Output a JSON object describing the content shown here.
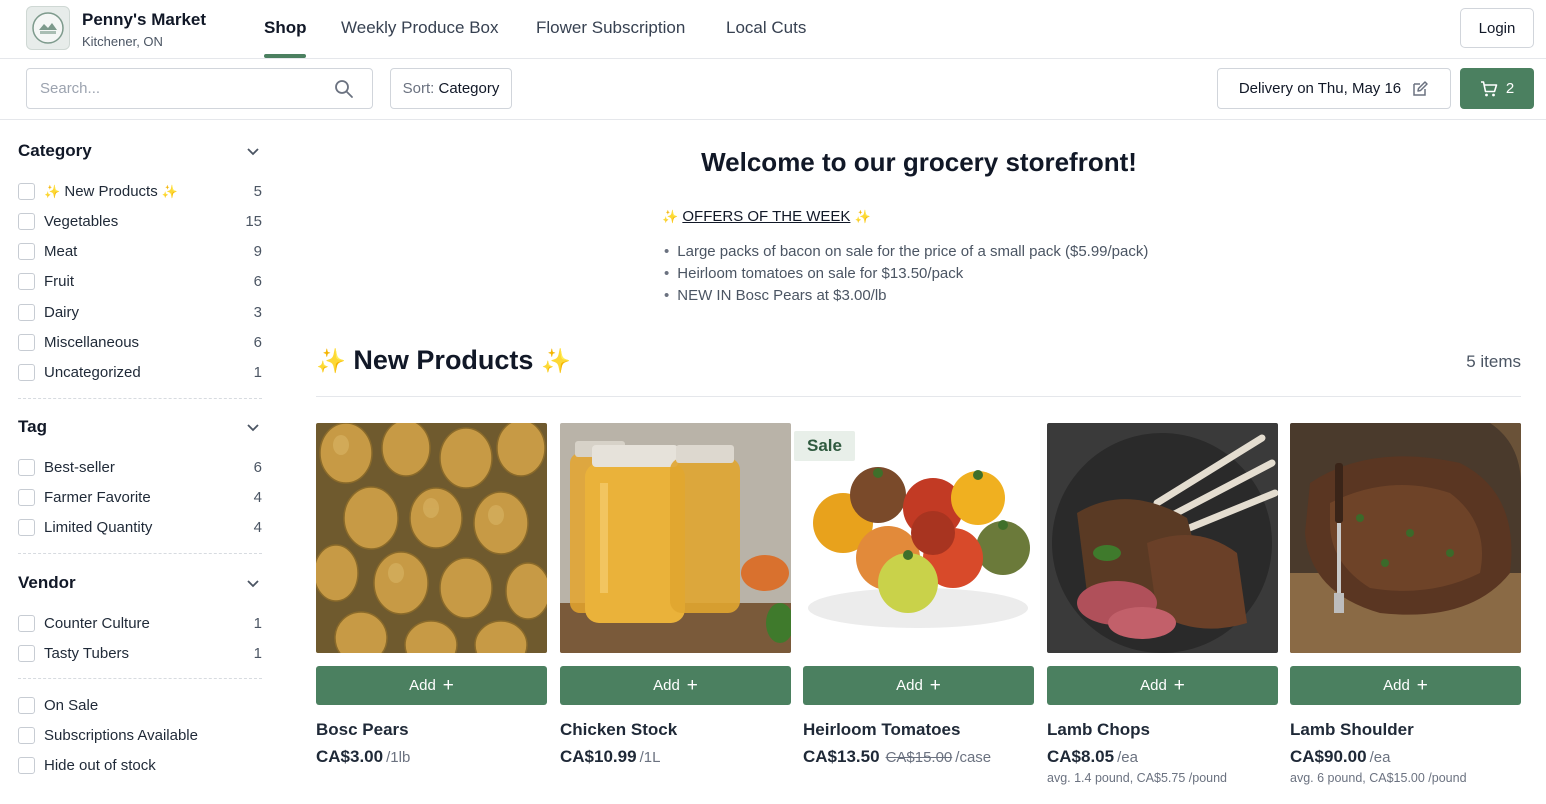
{
  "brand": {
    "name": "Penny's Market",
    "location": "Kitchener, ON"
  },
  "nav": {
    "tabs": [
      {
        "label": "Shop",
        "active": true
      },
      {
        "label": "Weekly Produce Box",
        "active": false
      },
      {
        "label": "Flower Subscription",
        "active": false
      },
      {
        "label": "Local Cuts",
        "active": false
      }
    ],
    "login_label": "Login"
  },
  "toolbar": {
    "search_placeholder": "Search...",
    "sort_prefix": "Sort:",
    "sort_value": "Category",
    "delivery_label": "Delivery on Thu, May 16",
    "cart_count": "2",
    "accent_color": "#4b8060"
  },
  "sidebar": {
    "category": {
      "title": "Category",
      "items": [
        {
          "label": "New Products",
          "count": "5",
          "sparkle": true
        },
        {
          "label": "Vegetables",
          "count": "15"
        },
        {
          "label": "Meat",
          "count": "9"
        },
        {
          "label": "Fruit",
          "count": "6"
        },
        {
          "label": "Dairy",
          "count": "3"
        },
        {
          "label": "Miscellaneous",
          "count": "6"
        },
        {
          "label": "Uncategorized",
          "count": "1"
        }
      ]
    },
    "tag": {
      "title": "Tag",
      "items": [
        {
          "label": "Best-seller",
          "count": "6"
        },
        {
          "label": "Farmer Favorite",
          "count": "4"
        },
        {
          "label": "Limited Quantity",
          "count": "4"
        }
      ]
    },
    "vendor": {
      "title": "Vendor",
      "items": [
        {
          "label": "Counter Culture",
          "count": "1"
        },
        {
          "label": "Tasty Tubers",
          "count": "1"
        }
      ]
    },
    "toggles": [
      {
        "label": "On Sale"
      },
      {
        "label": "Subscriptions Available"
      },
      {
        "label": "Hide out of stock"
      }
    ]
  },
  "main": {
    "welcome": "Welcome to our grocery storefront!",
    "offers_title": "OFFERS OF THE WEEK",
    "offers": [
      "Large packs of bacon on sale for the price of a small pack ($5.99/pack)",
      "Heirloom tomatoes on sale for $13.50/pack",
      "NEW IN Bosc Pears at $3.00/lb"
    ],
    "section_title": "New Products",
    "item_count": "5 items",
    "add_label": "Add",
    "products": [
      {
        "name": "Bosc Pears",
        "price": "CA$3.00",
        "unit": "/1lb",
        "old_price": "",
        "avg": "",
        "sale": false,
        "image_icon": "pears-photo"
      },
      {
        "name": "Chicken Stock",
        "price": "CA$10.99",
        "unit": "/1L",
        "old_price": "",
        "avg": "",
        "sale": false,
        "image_icon": "stock-jars-photo"
      },
      {
        "name": "Heirloom Tomatoes",
        "price": "CA$13.50",
        "unit": "/case",
        "old_price": "CA$15.00",
        "avg": "",
        "sale": true,
        "sale_label": "Sale",
        "image_icon": "tomatoes-photo"
      },
      {
        "name": "Lamb Chops",
        "price": "CA$8.05",
        "unit": "/ea",
        "old_price": "",
        "avg": "avg. 1.4 pound, CA$5.75 /pound",
        "sale": false,
        "image_icon": "lamb-chops-photo"
      },
      {
        "name": "Lamb Shoulder",
        "price": "CA$90.00",
        "unit": "/ea",
        "old_price": "",
        "avg": "avg. 6 pound, CA$15.00 /pound",
        "sale": false,
        "image_icon": "lamb-shoulder-photo"
      }
    ]
  }
}
